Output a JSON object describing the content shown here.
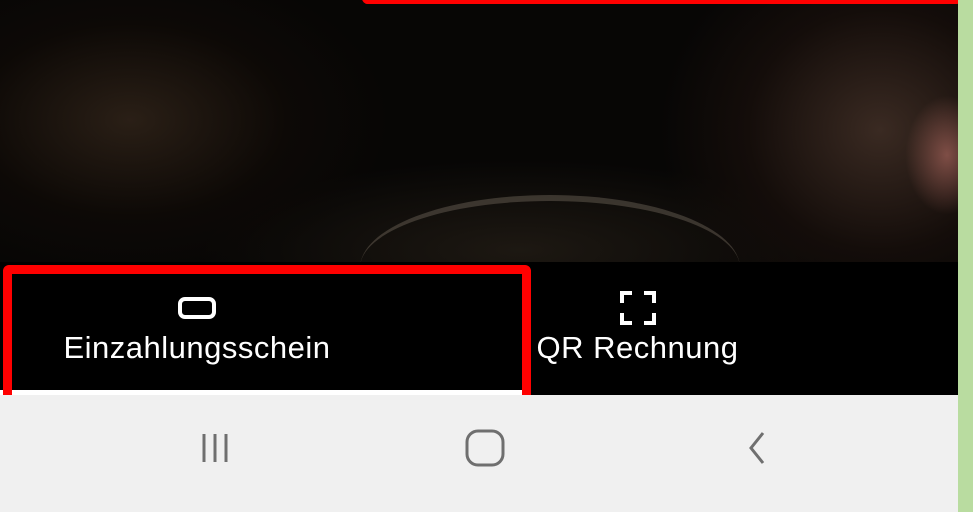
{
  "tabs": [
    {
      "label": "Einzahlungsschein",
      "icon": "rectangle-icon",
      "selected": true
    },
    {
      "label": "QR Rechnung",
      "icon": "scan-frame-icon",
      "selected": false
    }
  ],
  "navigation_bar": {
    "buttons": [
      "recent-apps-icon",
      "home-icon",
      "back-icon"
    ]
  },
  "colors": {
    "highlight_frame": "#ff0000",
    "tab_bar_background": "#000000",
    "nav_bar_background": "#f0f0f0",
    "outer_background": "#b9dca0"
  }
}
